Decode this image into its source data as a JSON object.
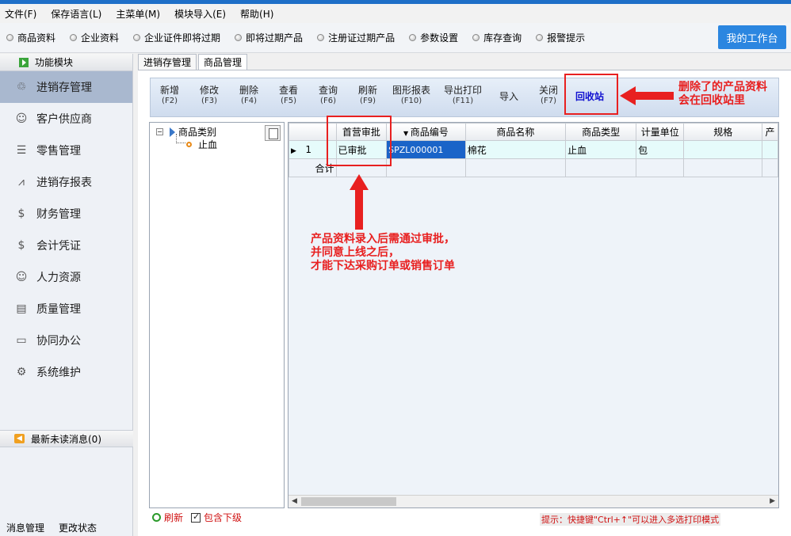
{
  "menubar": [
    "文件(F)",
    "保存语言(L)",
    "主菜单(M)",
    "模块导入(E)",
    "帮助(H)"
  ],
  "quickbar": {
    "items": [
      "商品资料",
      "企业资料",
      "企业证件即将过期",
      "即将过期产品",
      "注册证过期产品",
      "参数设置",
      "库存查询",
      "报警提示"
    ],
    "workbench_label": "我的工作台"
  },
  "sidebar": {
    "header": "功能模块",
    "items": [
      "进销存管理",
      "客户供应商",
      "零售管理",
      "进销存报表",
      "财务管理",
      "会计凭证",
      "人力资源",
      "质量管理",
      "协同办公",
      "系统维护"
    ],
    "messages": "最新未读消息(0)",
    "bottom": [
      "消息管理",
      "更改状态"
    ]
  },
  "tabs": [
    "进销存管理",
    "商品管理"
  ],
  "toolbar": [
    {
      "label": "新增",
      "key": "(F2)"
    },
    {
      "label": "修改",
      "key": "(F3)"
    },
    {
      "label": "删除",
      "key": "(F4)"
    },
    {
      "label": "查看",
      "key": "(F5)"
    },
    {
      "label": "查询",
      "key": "(F6)"
    },
    {
      "label": "刷新",
      "key": "(F9)"
    },
    {
      "label": "图形报表",
      "key": "(F10)"
    },
    {
      "label": "导出打印",
      "key": "(F11)"
    },
    {
      "label": "导入",
      "key": ""
    },
    {
      "label": "关闭",
      "key": "(F7)"
    },
    {
      "label": "回收站",
      "key": ""
    }
  ],
  "annotations": {
    "recycle_note_1": "删除了的产品资料",
    "recycle_note_2": "会在回收站里",
    "approve_note_1": "产品资料录入后需通过审批，",
    "approve_note_2": "并同意上线之后，",
    "approve_note_3": "才能下达采购订单或销售订单"
  },
  "tree": {
    "root": "商品类别",
    "child": "止血"
  },
  "grid": {
    "columns": [
      "",
      "首营审批",
      "商品编号",
      "商品名称",
      "商品类型",
      "计量单位",
      "规格",
      "产"
    ],
    "row": {
      "index": "1",
      "approval": "已审批",
      "code": "SPZL000001",
      "name": "棉花",
      "type": "止血",
      "unit": "包",
      "spec": ""
    },
    "sum_label": "合计"
  },
  "bottom": {
    "refresh": "刷新",
    "include_sub": "包含下级",
    "hint": "提示：快捷键\"Ctrl+↑\"可以进入多选打印模式"
  }
}
